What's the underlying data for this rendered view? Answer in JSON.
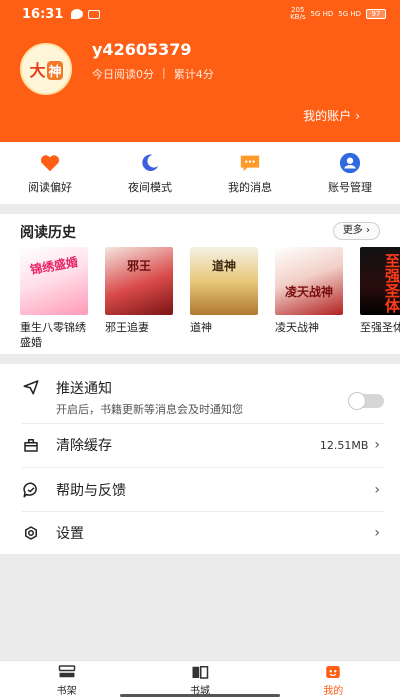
{
  "statusbar": {
    "time": "16:31",
    "net_speed_top": "205",
    "net_speed_bottom": "KB/s",
    "signal1": "5G HD",
    "signal2": "5G HD",
    "battery": "97"
  },
  "profile": {
    "username": "y42605379",
    "today_read": "今日阅读0分",
    "total_read": "累计4分",
    "account_link": "我的账户"
  },
  "quick_actions": [
    {
      "label": "阅读偏好",
      "icon": "heart-icon"
    },
    {
      "label": "夜间模式",
      "icon": "moon-icon"
    },
    {
      "label": "我的消息",
      "icon": "message-icon"
    },
    {
      "label": "账号管理",
      "icon": "user-icon"
    }
  ],
  "history": {
    "title": "阅读历史",
    "more_label": "更多",
    "books": [
      {
        "title": "重生八零锦绣盛婚"
      },
      {
        "title": "邪王追妻"
      },
      {
        "title": "道神"
      },
      {
        "title": "凌天战神"
      },
      {
        "title": "至强圣体"
      }
    ]
  },
  "settings": {
    "push": {
      "label": "推送通知",
      "sub": "开启后，书籍更新等消息会及时通知您",
      "enabled": false
    },
    "cache": {
      "label": "清除缓存",
      "value": "12.51MB"
    },
    "help": {
      "label": "帮助与反馈"
    },
    "general": {
      "label": "设置"
    }
  },
  "bottom_nav": [
    {
      "label": "书架",
      "icon": "bookshelf-icon"
    },
    {
      "label": "书城",
      "icon": "bookstore-icon"
    },
    {
      "label": "我的",
      "icon": "profile-icon",
      "active": true
    }
  ],
  "colors": {
    "brand": "#ff5f14",
    "background": "#ececec"
  }
}
